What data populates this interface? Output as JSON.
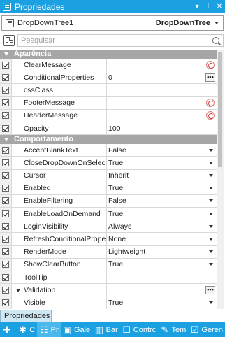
{
  "window": {
    "title": "Propriedades",
    "buttons": {
      "dropdown": "▾",
      "pin": "⊥",
      "close": "✕"
    }
  },
  "object_selector": {
    "name": "DropDownTree1",
    "type": "DropDownTree"
  },
  "search": {
    "placeholder": "Pesquisar"
  },
  "categories": [
    {
      "label": "Aparência",
      "properties": [
        {
          "name": "ClearMessage",
          "value": "",
          "editor": "reset"
        },
        {
          "name": "ConditionalProperties",
          "value": "0",
          "editor": "ellipsis"
        },
        {
          "name": "cssClass",
          "value": "",
          "editor": "none"
        },
        {
          "name": "FooterMessage",
          "value": "",
          "editor": "reset"
        },
        {
          "name": "HeaderMessage",
          "value": "",
          "editor": "reset"
        },
        {
          "name": "Opacity",
          "value": "100",
          "editor": "none"
        }
      ]
    },
    {
      "label": "Comportamento",
      "properties": [
        {
          "name": "AcceptBlankText",
          "value": "False",
          "editor": "dropdown"
        },
        {
          "name": "CloseDropDownOnSelection",
          "value": "True",
          "editor": "dropdown"
        },
        {
          "name": "Cursor",
          "value": "Inherit",
          "editor": "dropdown"
        },
        {
          "name": "Enabled",
          "value": "True",
          "editor": "dropdown"
        },
        {
          "name": "EnableFiltering",
          "value": "False",
          "editor": "dropdown"
        },
        {
          "name": "EnableLoadOnDemand",
          "value": "True",
          "editor": "dropdown"
        },
        {
          "name": "LoginVisibility",
          "value": "Always",
          "editor": "dropdown"
        },
        {
          "name": "RefreshConditionalProperties",
          "value": "None",
          "editor": "dropdown"
        },
        {
          "name": "RenderMode",
          "value": "Lightweight",
          "editor": "dropdown"
        },
        {
          "name": "ShowClearButton",
          "value": "True",
          "editor": "dropdown"
        },
        {
          "name": "ToolTip",
          "value": "",
          "editor": "none"
        },
        {
          "name": "Validation",
          "value": "",
          "editor": "ellipsis",
          "expandable": true
        },
        {
          "name": "Visible",
          "value": "True",
          "editor": "dropdown"
        }
      ]
    }
  ],
  "bottom_tab": {
    "label": "Propriedades"
  },
  "bottom_bar": {
    "items": [
      {
        "icon": "add-icon",
        "label": ""
      },
      {
        "icon": "gear-icon",
        "label": "C"
      },
      {
        "icon": "properties-icon",
        "label": "Pr",
        "active": true
      },
      {
        "icon": "gallery-icon",
        "label": "Gale"
      },
      {
        "icon": "database-icon",
        "label": "Bar"
      },
      {
        "icon": "controls-icon",
        "label": "Contrc"
      },
      {
        "icon": "theme-icon",
        "label": "Tem"
      },
      {
        "icon": "generator-icon",
        "label": "Geren"
      }
    ]
  }
}
